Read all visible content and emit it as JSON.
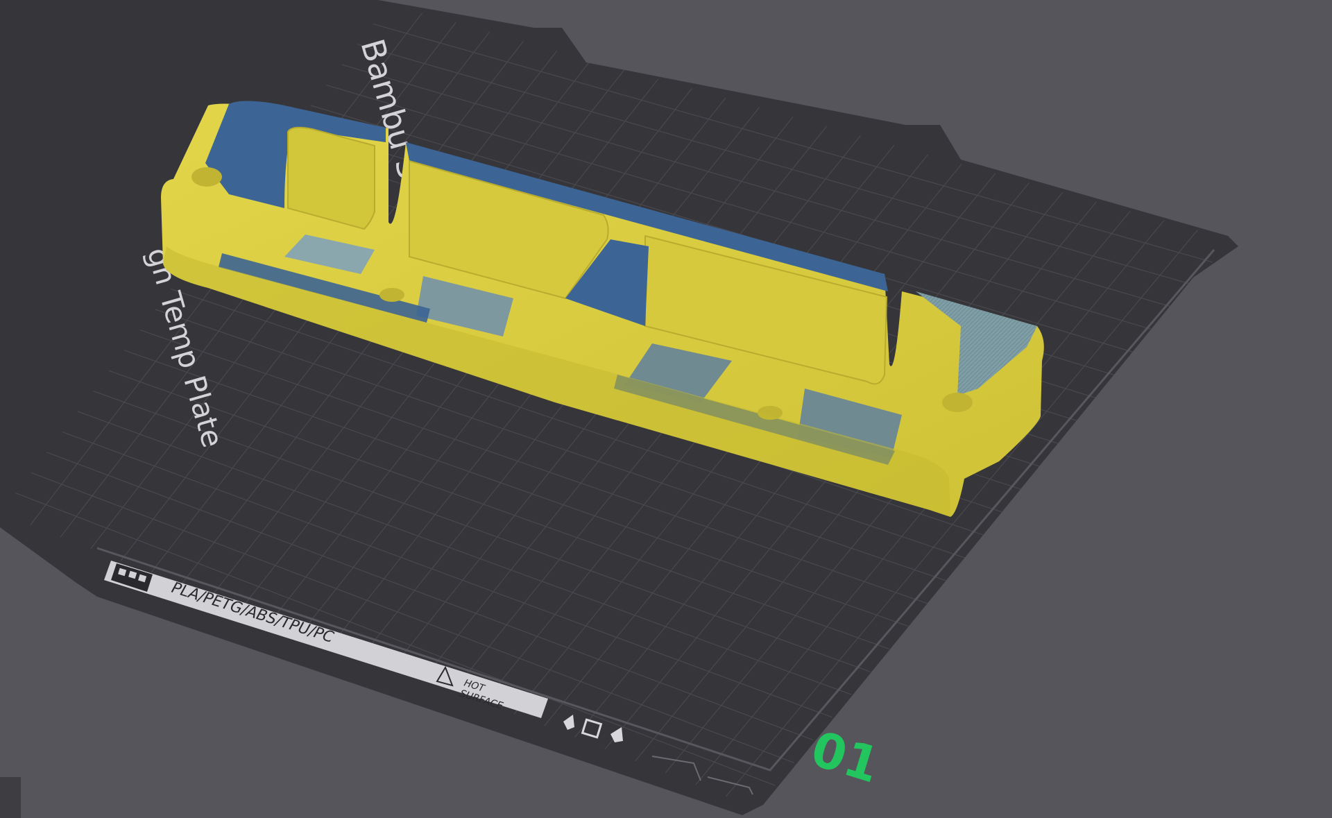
{
  "plate": {
    "brand_text": "Bambu Sm",
    "type_text": "gh Temp Plate",
    "materials_text": "PLA/PETG/ABS/TPU/PC",
    "warning_line1": "HOT",
    "warning_line2": "SURFACE",
    "plate_number": "01"
  },
  "colors": {
    "background": "#55555b",
    "plate": "#36363a",
    "grid": "#4a4a50",
    "model_yellow": "#d8cc3c",
    "model_shadow": "#b3a82c",
    "model_blue": "#3c6494",
    "plate_number": "#22c55e"
  },
  "icons": {
    "plate_logo": "bambu-logo-icon",
    "warning": "warning-triangle-icon",
    "orientation": "plate-orientation-icon"
  }
}
